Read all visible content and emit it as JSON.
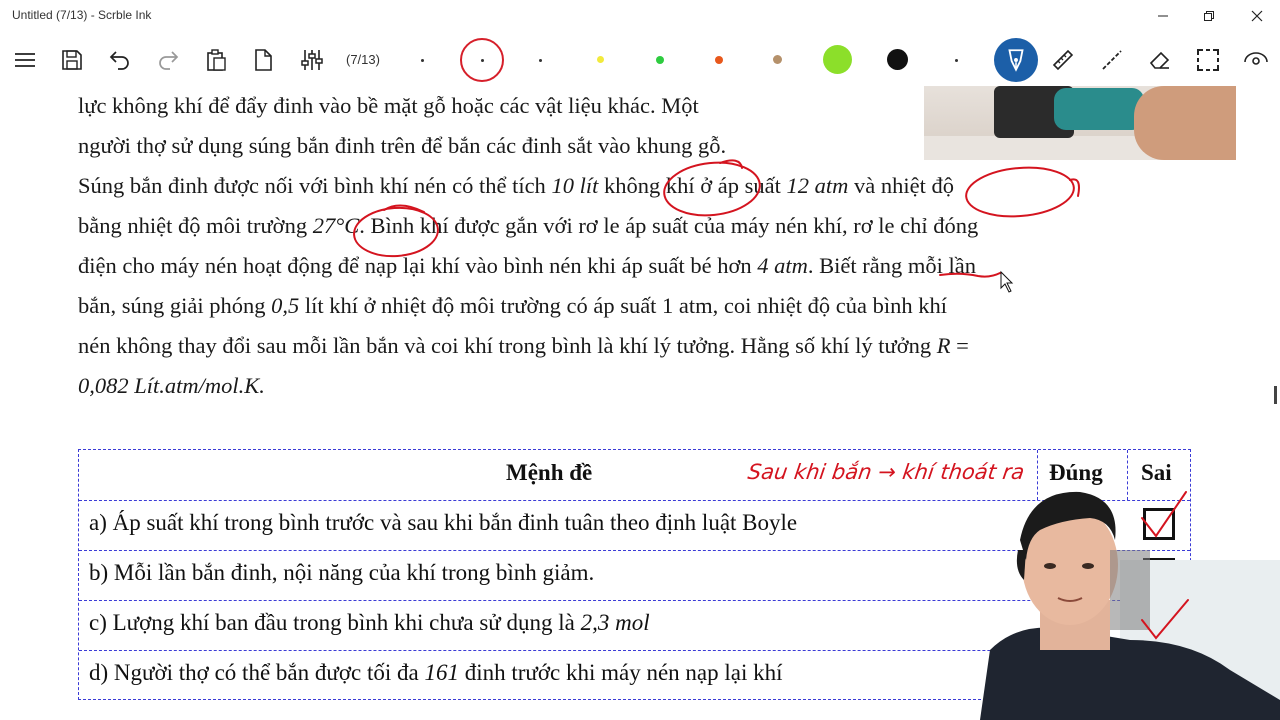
{
  "window": {
    "title": "Untitled (7/13) - Scrble Ink",
    "minimize": "—",
    "maximize": "❐",
    "close": "✕"
  },
  "toolbar": {
    "page_indicator": "(7/13)",
    "icons": [
      "menu-icon",
      "save-icon",
      "undo-icon",
      "redo-icon",
      "paste-icon",
      "new-page-icon",
      "settings-sliders-icon"
    ],
    "pen_colors": [
      "#333333",
      "#d61f2a",
      "#333333",
      "#f2ea3c",
      "#2ecc40",
      "#e8581c",
      "#b5916b",
      "#8cdf2a",
      "#111111",
      "#333333"
    ],
    "tools": [
      "pen-icon",
      "ruler-icon",
      "line-icon",
      "eraser-icon",
      "selection-icon",
      "view-icon"
    ]
  },
  "document": {
    "lines": [
      {
        "parts": [
          {
            "t": "lực không khí để đẩy đinh vào bề mặt gỗ hoặc các vật liệu khác. Một"
          }
        ]
      },
      {
        "parts": [
          {
            "t": "người thợ sử dụng súng bắn đinh trên để bắn các đinh sắt vào khung gỗ."
          }
        ]
      },
      {
        "parts": [
          {
            "t": "Súng bắn đinh được nối với bình khí nén có thể tích "
          },
          {
            "t": "10 lít",
            "i": true
          },
          {
            "t": " không khí ở áp suất "
          },
          {
            "t": "12 atm",
            "i": true
          },
          {
            "t": " và nhiệt độ"
          }
        ]
      },
      {
        "parts": [
          {
            "t": "bằng nhiệt độ môi trường "
          },
          {
            "t": "27°C",
            "i": true
          },
          {
            "t": ". Bình khí được gắn với rơ le áp suất của máy nén khí, rơ le chỉ đóng"
          }
        ]
      },
      {
        "parts": [
          {
            "t": "điện cho máy nén hoạt động để nạp lại khí vào bình nén khi áp suất bé hơn "
          },
          {
            "t": "4 atm",
            "i": true
          },
          {
            "t": ". Biết rằng mỗi lần"
          }
        ]
      },
      {
        "parts": [
          {
            "t": "bắn, súng giải phóng "
          },
          {
            "t": "0,5",
            "i": true
          },
          {
            "t": " lít khí ở nhiệt độ môi trường có áp suất 1 atm, coi nhiệt độ của bình khí"
          }
        ]
      },
      {
        "parts": [
          {
            "t": "nén không thay đổi sau mỗi lần bắn và coi khí trong bình là khí lý tưởng. Hằng số khí lý tưởng "
          },
          {
            "t": "R",
            "i": true
          },
          {
            "t": " ="
          }
        ]
      },
      {
        "parts": [
          {
            "t": "0,082 Lít.atm/mol.K.",
            "i": true
          }
        ]
      }
    ],
    "table": {
      "header": {
        "statement": "Mệnh đề",
        "true": "Đúng",
        "false": "Sai"
      },
      "rows": [
        {
          "parts": [
            {
              "t": "a) Áp suất khí trong bình trước và sau khi bắn đinh tuân theo định luật Boyle"
            }
          ]
        },
        {
          "parts": [
            {
              "t": "b) Mỗi lần bắn đinh, nội năng của khí trong bình giảm."
            }
          ]
        },
        {
          "parts": [
            {
              "t": "c) Lượng khí ban đầu trong bình khi chưa sử dụng là "
            },
            {
              "t": "2,3 mol",
              "i": true
            }
          ]
        },
        {
          "parts": [
            {
              "t": "d) Người thợ có thể bắn được tối đa "
            },
            {
              "t": "161",
              "i": true
            },
            {
              "t": " đinh trước khi máy nén nạp lại khí"
            }
          ]
        }
      ],
      "checked_false": [
        true,
        false,
        true,
        false
      ]
    },
    "annotation_note": "Sau khi bắn → khí thoát ra"
  },
  "colors": {
    "ink_red": "#d4141f",
    "table_border": "#3b3bd6",
    "active_tool": "#1c5fa8"
  }
}
